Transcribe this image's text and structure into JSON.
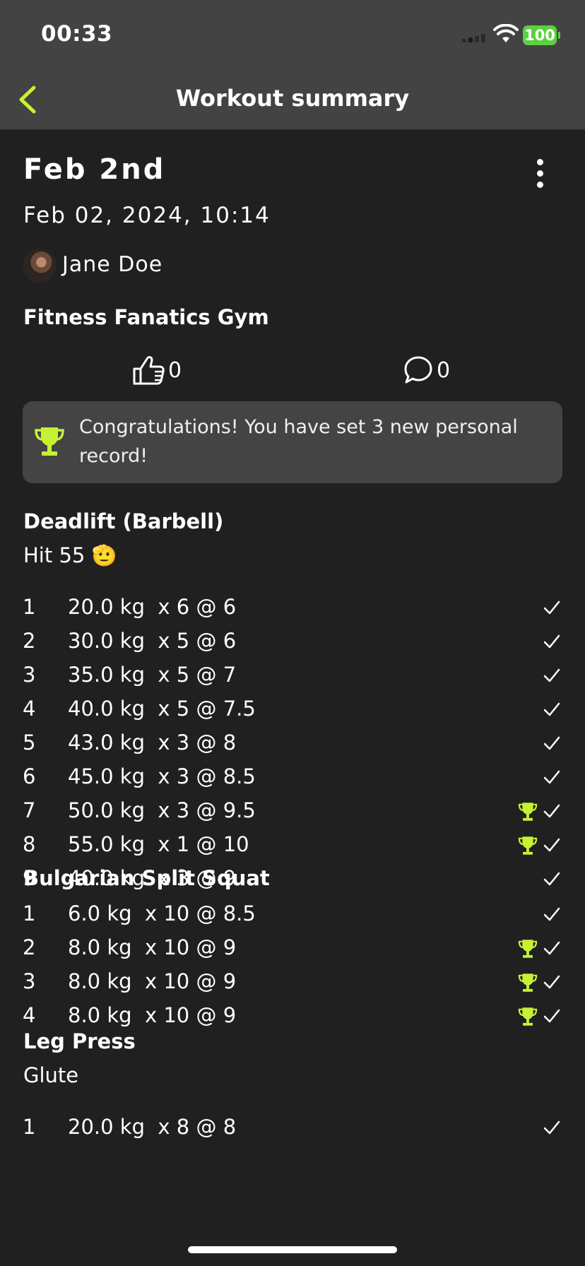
{
  "status": {
    "time": "00:33",
    "battery": "100"
  },
  "nav": {
    "title": "Workout summary"
  },
  "workout": {
    "title": "Feb 2nd",
    "date": "Feb 02, 2024, 10:14",
    "user": "Jane Doe",
    "gym": "Fitness Fanatics Gym",
    "likes": "0",
    "comments": "0"
  },
  "pr_banner": {
    "text": "Congratulations! You have set 3 new personal record!"
  },
  "exercises": [
    {
      "name": "Deadlift (Barbell)",
      "note": "Hit 55 🫡",
      "sets": [
        {
          "idx": "1",
          "detail": "20.0 kg  x 6 @ 6",
          "pr": false
        },
        {
          "idx": "2",
          "detail": "30.0 kg  x 5 @ 6",
          "pr": false
        },
        {
          "idx": "3",
          "detail": "35.0 kg  x 5 @ 7",
          "pr": false
        },
        {
          "idx": "4",
          "detail": "40.0 kg  x 5 @ 7.5",
          "pr": false
        },
        {
          "idx": "5",
          "detail": "43.0 kg  x 3 @ 8",
          "pr": false
        },
        {
          "idx": "6",
          "detail": "45.0 kg  x 3 @ 8.5",
          "pr": false
        },
        {
          "idx": "7",
          "detail": "50.0 kg  x 3 @ 9.5",
          "pr": true
        },
        {
          "idx": "8",
          "detail": "55.0 kg  x 1 @ 10",
          "pr": true
        },
        {
          "idx": "9",
          "detail": "40.0 kg  x 3 @ 9",
          "pr": false
        }
      ]
    },
    {
      "name": "Bulgarian Split Squat",
      "note": "",
      "sets": [
        {
          "idx": "1",
          "detail": "6.0 kg  x 10 @ 8.5",
          "pr": false
        },
        {
          "idx": "2",
          "detail": "8.0 kg  x 10 @ 9",
          "pr": true
        },
        {
          "idx": "3",
          "detail": "8.0 kg  x 10 @ 9",
          "pr": true
        },
        {
          "idx": "4",
          "detail": "8.0 kg  x 10 @ 9",
          "pr": true
        }
      ]
    },
    {
      "name": "Leg Press",
      "note": "Glute",
      "sets": [
        {
          "idx": "1",
          "detail": "20.0 kg  x 8 @ 8",
          "pr": false
        }
      ]
    }
  ],
  "colors": {
    "accent": "#c6f135",
    "background": "#202020",
    "bar": "#434343",
    "banner": "#444444"
  },
  "icons": {
    "back": "chevron-left-icon",
    "more": "vertical-dots-icon",
    "like": "thumbs-up-icon",
    "comment": "speech-bubble-icon",
    "trophy": "trophy-icon",
    "check": "checkmark-icon"
  }
}
